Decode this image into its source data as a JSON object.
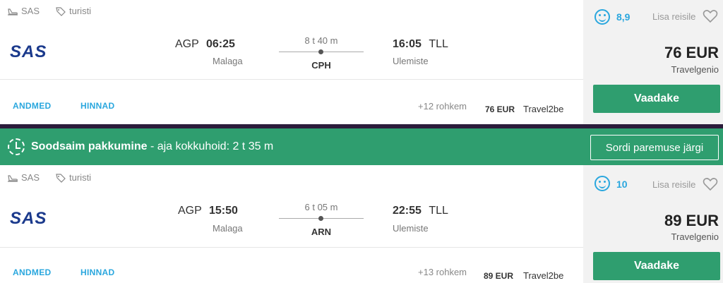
{
  "flights": [
    {
      "airline": "SAS",
      "cabin": "turisti",
      "logo_text": "SAS",
      "dep_code": "AGP",
      "dep_time": "06:25",
      "dep_city": "Malaga",
      "duration": "8 t 40 m",
      "stop": "CPH",
      "arr_time": "16:05",
      "arr_code": "TLL",
      "arr_city": "Ulemiste",
      "details_link": "ANDMED",
      "prices_link": "HINNAD",
      "more": "+12 rohkem",
      "alt_price": "76 EUR",
      "alt_provider": "Travel2be",
      "score": "8,9",
      "fav_label": "Lisa reisile",
      "price": "76 EUR",
      "provider": "Travelgenio",
      "button": "Vaadake"
    },
    {
      "airline": "SAS",
      "cabin": "turisti",
      "logo_text": "SAS",
      "dep_code": "AGP",
      "dep_time": "15:50",
      "dep_city": "Malaga",
      "duration": "6 t 05 m",
      "stop": "ARN",
      "arr_time": "22:55",
      "arr_code": "TLL",
      "arr_city": "Ulemiste",
      "details_link": "ANDMED",
      "prices_link": "HINNAD",
      "more": "+13 rohkem",
      "alt_price": "89 EUR",
      "alt_provider": "Travel2be",
      "score": "10",
      "fav_label": "Lisa reisile",
      "price": "89 EUR",
      "provider": "Travelgenio",
      "button": "Vaadake"
    }
  ],
  "banner": {
    "title": "Soodsaim pakkumine",
    "subtitle": " - aja kokkuhoid: 2 t 35 m",
    "sort_button": "Sordi paremuse järgi"
  },
  "colors": {
    "accent_green": "#2f9e6f",
    "link_blue": "#2aa7de",
    "logo_blue": "#1b3a8c",
    "separator": "#2b1c3b"
  }
}
